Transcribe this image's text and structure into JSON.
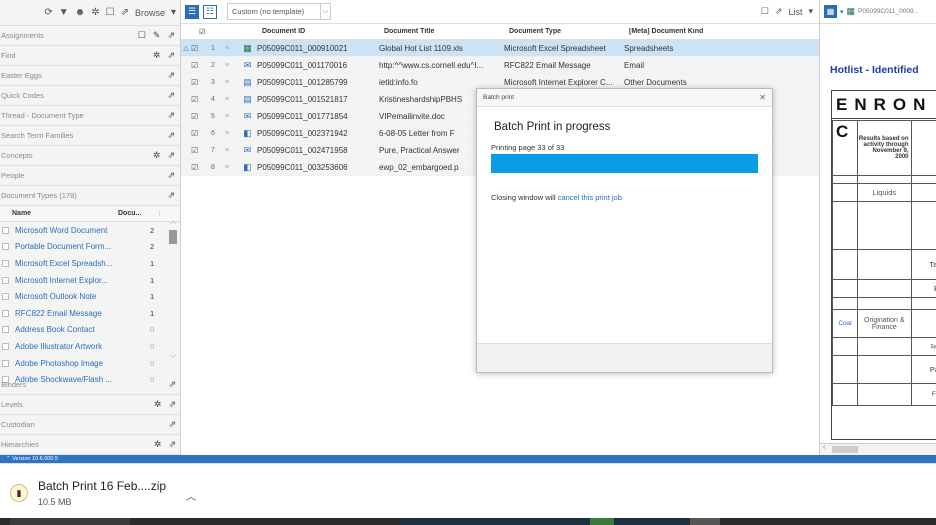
{
  "left": {
    "toolbar": {
      "browse_label": "Browse"
    },
    "nav": [
      {
        "label": "Assignments"
      },
      {
        "label": "Find"
      },
      {
        "label": "Easter Eggs"
      },
      {
        "label": "Quick Codes"
      },
      {
        "label": "Thread - Document Type"
      },
      {
        "label": "Search Term Families"
      },
      {
        "label": "Concepts"
      },
      {
        "label": "People"
      },
      {
        "label": "Document Types (178)"
      }
    ],
    "dt_header": {
      "name": "Name",
      "count": "Docu..."
    },
    "doc_types": [
      {
        "name": "Microsoft Word Document",
        "count": "2"
      },
      {
        "name": "Portable Document Form...",
        "count": "2"
      },
      {
        "name": "Microsoft Excel Spreadsh...",
        "count": "1"
      },
      {
        "name": "Microsoft Internet Explor...",
        "count": "1"
      },
      {
        "name": "Microsoft Outlook Note",
        "count": "1"
      },
      {
        "name": "RFC822 Email Message",
        "count": "1"
      },
      {
        "name": "Address Book Contact",
        "count": "0"
      },
      {
        "name": "Adobe Illustrator Artwork",
        "count": "0"
      },
      {
        "name": "Adobe Photoshop Image",
        "count": "0"
      },
      {
        "name": "Adobe Shockwave/Flash ...",
        "count": "0"
      }
    ],
    "nav_bottom": [
      {
        "label": "Binders"
      },
      {
        "label": "Levels"
      },
      {
        "label": "Custodian"
      },
      {
        "label": "Hierarchies"
      }
    ]
  },
  "grid": {
    "template": "Custom (no template)",
    "list_label": "List",
    "columns": {
      "id": "Document ID",
      "title": "Document Title",
      "type": "Document Type",
      "kind": "[Meta] Document Kind"
    },
    "rows": [
      {
        "n": "1",
        "id": "P05099C011_000910021",
        "title": "Global Hot List 1109.xls",
        "type": "Microsoft Excel Spreadsheet",
        "kind": "Spreadsheets",
        "icon": "▦",
        "icon_color": "#1e7145"
      },
      {
        "n": "2",
        "id": "P05099C011_001170016",
        "title": "http:^^www.cs.cornell.edu^I...",
        "type": "RFC822 Email Message",
        "kind": "Email",
        "icon": "✉",
        "icon_color": "#2a6ebb"
      },
      {
        "n": "3",
        "id": "P05099C011_001285799",
        "title": "ietld:info.fo",
        "type": "Microsoft Internet Explorer C...",
        "kind": "Other Documents",
        "icon": "▤",
        "icon_color": "#2a6ebb"
      },
      {
        "n": "4",
        "id": "P05099C011_001521817",
        "title": "KristineshardshipPBHS",
        "type": "",
        "kind": "",
        "icon": "▤",
        "icon_color": "#2a6ebb"
      },
      {
        "n": "5",
        "id": "P05099C011_001771854",
        "title": "VIPemailinvite.doc",
        "type": "",
        "kind": "",
        "icon": "✉",
        "icon_color": "#2a6ebb"
      },
      {
        "n": "6",
        "id": "P05099C011_002371942",
        "title": "6-08-05 Letter from F",
        "type": "",
        "kind": "",
        "icon": "◧",
        "icon_color": "#2a6ebb"
      },
      {
        "n": "7",
        "id": "P05099C011_002471958",
        "title": "Pure, Practical Answer",
        "type": "",
        "kind": "",
        "icon": "✉",
        "icon_color": "#2a6ebb"
      },
      {
        "n": "8",
        "id": "P05099C011_003253606",
        "title": "ewp_02_embargoed.p",
        "type": "",
        "kind": "",
        "icon": "◧",
        "icon_color": "#2a6ebb"
      }
    ]
  },
  "preview": {
    "file_id": "P05099C011_0009...",
    "hotlist_title": "Hotlist - Identified",
    "logo_text": "ENRON C",
    "results_text": "Results based on activity through November 9, 2000",
    "liquids": "Liquids",
    "tai": "Tai",
    "coal": "Coal",
    "origination": "Origination & Finance",
    "pa": "Pa",
    "syn": "Syn",
    "fo": "Fo",
    "e": "E"
  },
  "modal": {
    "title": "Batch print",
    "heading": "Batch Print in progress",
    "status": "Printing page 33 of 33",
    "progress": 1.0,
    "closing_text": "Closing window will",
    "cancel_link": "cancel this print job"
  },
  "version": "Version 10.6.000.5",
  "download": {
    "name": "Batch Print 16 Feb....zip",
    "size": "10.5 MB"
  }
}
